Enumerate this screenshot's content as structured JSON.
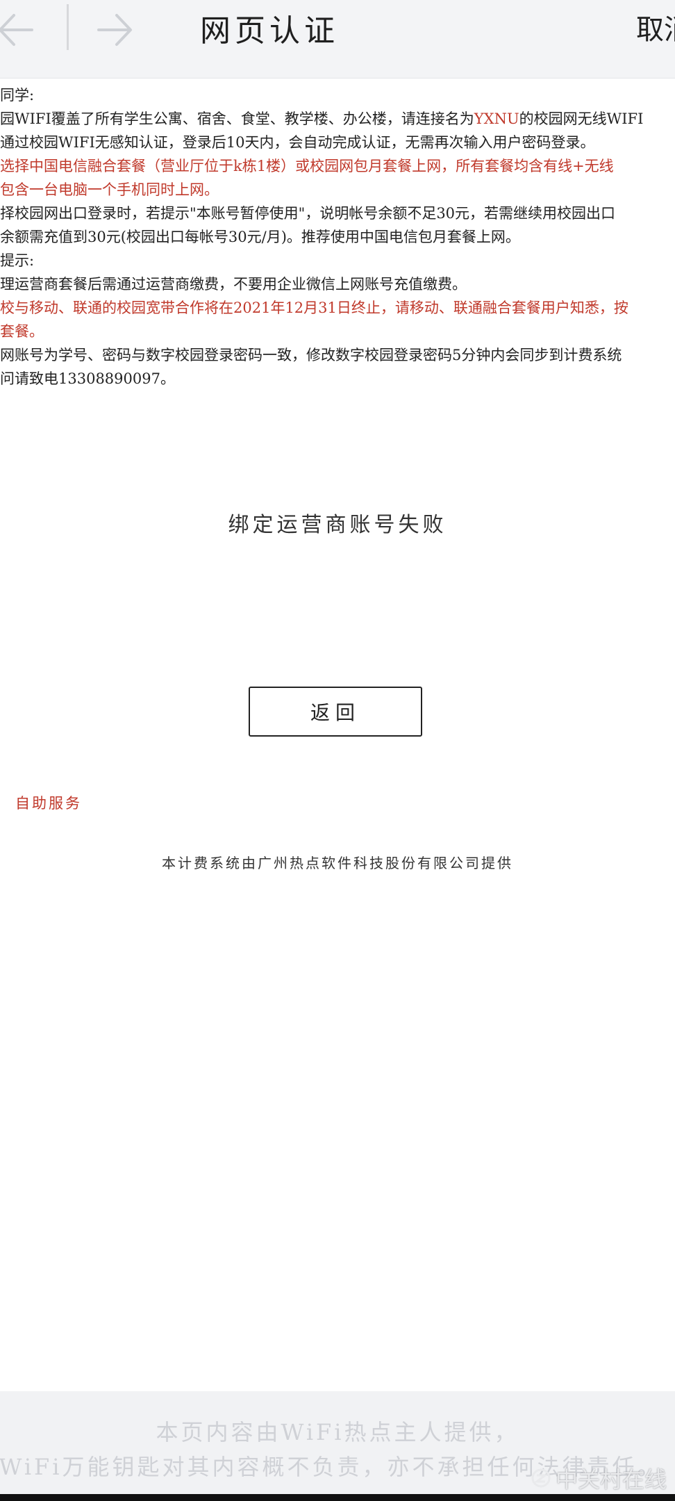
{
  "header": {
    "title": "网页认证",
    "cancel_label": "取消"
  },
  "notice": {
    "lines": [
      "同学:",
      "园WIFI覆盖了所有学生公寓、宿舍、食堂、教学楼、办公楼，请连接名为YXNU的校园网无线WIFI",
      "通过校园WIFI无感知认证，登录后10天内，会自动完成认证，无需再次输入用户密码登录。",
      "选择中国电信融合套餐（营业厅位于k栋1楼）或校园网包月套餐上网，所有套餐均含有线+无线",
      "包含一台电脑一个手机同时上网。",
      "择校园网出口登录时，若提示\"本账号暂停使用\"，说明帐号余额不足30元，若需继续用校园出口",
      "余额需充值到30元(校园出口每帐号30元/月)。推荐使用中国电信包月套餐上网。",
      "提示:",
      "理运营商套餐后需通过运营商缴费，不要用企业微信上网账号充值缴费。",
      "校与移动、联通的校园宽带合作将在2021年12月31日终止，请移动、联通融合套餐用户知悉，按",
      "套餐。",
      "网账号为学号、密码与数字校园登录密码一致，修改数字校园登录密码5分钟内会同步到计费系统",
      "问请致电13308890097。"
    ]
  },
  "result_message": "绑定运营商账号失败",
  "return_button_label": "返回",
  "self_service_link": "自助服务",
  "provider_text": "本计费系统由广州热点软件科技股份有限公司提供",
  "footer": {
    "line1": "本页内容由WiFi热点主人提供，",
    "line2": "WiFi万能钥匙对其内容概不负责，亦不承担任何法律责任。"
  },
  "watermark": "中关村在线",
  "colors": {
    "accent_red": "#c0392b",
    "header_bg": "#f3f4f6",
    "footer_bg": "#f1f2f4"
  }
}
